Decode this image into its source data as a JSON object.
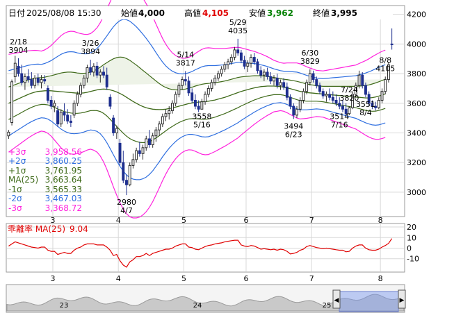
{
  "header": {
    "date_label": "日付",
    "datetime": "2025/08/08 15:30",
    "open_label": "始値",
    "open_value": "4,000",
    "high_label": "高値",
    "high_value": "4,105",
    "low_label": "安値",
    "low_value": "3,962",
    "close_label": "終値",
    "close_value": "3,995"
  },
  "colors": {
    "up": "#2b2b2b",
    "down": "#1e2f8e",
    "ma": "#3f6a1a",
    "sigma1": "#3f6a1a",
    "sigma2": "#2f6fe0",
    "sigma3": "#ff22dd",
    "deviation": "#e00000",
    "high_value": "#e00000",
    "low_value": "#008000"
  },
  "legend": [
    {
      "label": "+3σ",
      "value": "3,958.56",
      "color": "#ff22dd"
    },
    {
      "label": "+2σ",
      "value": "3,860.25",
      "color": "#2f6fe0"
    },
    {
      "label": "+1σ",
      "value": "3,761.95",
      "color": "#3f6a1a"
    },
    {
      "label": "MA(25)",
      "value": "3,663.64",
      "color": "#3f6a1a"
    },
    {
      "label": "-1σ",
      "value": "3,565.33",
      "color": "#3f6a1a"
    },
    {
      "label": "-2σ",
      "value": "3,467.03",
      "color": "#2f6fe0"
    },
    {
      "label": "-3σ",
      "value": "3,368.72",
      "color": "#ff22dd"
    }
  ],
  "deviation_label": "乖離率 MA(25)",
  "deviation_value": "9.04",
  "navigator": {
    "ticks": [
      "23",
      "24",
      "25"
    ]
  },
  "chart_data": {
    "type": "candlestick",
    "title": "",
    "y_axis": {
      "ticks": [
        3000,
        3200,
        3400,
        3600,
        3800,
        4000,
        4200
      ],
      "range": [
        2840,
        4250
      ]
    },
    "x_axis": {
      "month_ticks": [
        {
          "label": "3",
          "index": 14
        },
        {
          "label": "4",
          "index": 34
        },
        {
          "label": "5",
          "index": 54
        },
        {
          "label": "6",
          "index": 73
        },
        {
          "label": "7",
          "index": 93
        },
        {
          "label": "8",
          "index": 114
        }
      ]
    },
    "candles": [
      [
        3380,
        3420,
        3360,
        3405
      ],
      [
        3470,
        3760,
        3450,
        3745
      ],
      [
        3780,
        3920,
        3740,
        3870
      ],
      [
        3850,
        3904,
        3780,
        3800
      ],
      [
        3800,
        3860,
        3720,
        3740
      ],
      [
        3740,
        3800,
        3690,
        3780
      ],
      [
        3780,
        3830,
        3740,
        3760
      ],
      [
        3760,
        3810,
        3700,
        3720
      ],
      [
        3720,
        3790,
        3700,
        3770
      ],
      [
        3770,
        3800,
        3720,
        3740
      ],
      [
        3740,
        3790,
        3700,
        3760
      ],
      [
        3760,
        3790,
        3730,
        3750
      ],
      [
        3700,
        3720,
        3600,
        3620
      ],
      [
        3620,
        3650,
        3560,
        3580
      ],
      [
        3580,
        3620,
        3540,
        3600
      ],
      [
        3550,
        3580,
        3440,
        3460
      ],
      [
        3460,
        3560,
        3440,
        3540
      ],
      [
        3540,
        3600,
        3480,
        3520
      ],
      [
        3520,
        3560,
        3460,
        3480
      ],
      [
        3480,
        3520,
        3440,
        3470
      ],
      [
        3520,
        3620,
        3500,
        3600
      ],
      [
        3600,
        3680,
        3580,
        3660
      ],
      [
        3660,
        3740,
        3640,
        3720
      ],
      [
        3720,
        3790,
        3700,
        3770
      ],
      [
        3770,
        3860,
        3740,
        3840
      ],
      [
        3840,
        3894,
        3790,
        3810
      ],
      [
        3810,
        3870,
        3780,
        3850
      ],
      [
        3850,
        3880,
        3770,
        3790
      ],
      [
        3790,
        3830,
        3740,
        3810
      ],
      [
        3810,
        3850,
        3770,
        3790
      ],
      [
        3790,
        3840,
        3690,
        3710
      ],
      [
        3640,
        3660,
        3560,
        3580
      ],
      [
        3500,
        3520,
        3380,
        3400
      ],
      [
        3400,
        3450,
        3360,
        3430
      ],
      [
        3330,
        3360,
        3180,
        3200
      ],
      [
        3200,
        3280,
        3060,
        3080
      ],
      [
        3080,
        3120,
        2980,
        3050
      ],
      [
        3050,
        3200,
        3040,
        3180
      ],
      [
        3180,
        3260,
        3160,
        3220
      ],
      [
        3220,
        3300,
        3200,
        3280
      ],
      [
        3280,
        3340,
        3240,
        3260
      ],
      [
        3260,
        3320,
        3220,
        3300
      ],
      [
        3300,
        3380,
        3280,
        3360
      ],
      [
        3360,
        3420,
        3300,
        3320
      ],
      [
        3320,
        3400,
        3300,
        3380
      ],
      [
        3380,
        3440,
        3340,
        3420
      ],
      [
        3420,
        3480,
        3380,
        3460
      ],
      [
        3460,
        3530,
        3440,
        3510
      ],
      [
        3510,
        3560,
        3480,
        3530
      ],
      [
        3530,
        3580,
        3490,
        3550
      ],
      [
        3550,
        3620,
        3530,
        3600
      ],
      [
        3600,
        3680,
        3580,
        3660
      ],
      [
        3660,
        3740,
        3640,
        3720
      ],
      [
        3720,
        3780,
        3690,
        3760
      ],
      [
        3760,
        3817,
        3720,
        3750
      ],
      [
        3750,
        3780,
        3650,
        3670
      ],
      [
        3670,
        3700,
        3600,
        3620
      ],
      [
        3620,
        3660,
        3560,
        3580
      ],
      [
        3580,
        3620,
        3540,
        3560
      ],
      [
        3560,
        3630,
        3558,
        3610
      ],
      [
        3610,
        3680,
        3590,
        3660
      ],
      [
        3660,
        3720,
        3640,
        3700
      ],
      [
        3700,
        3760,
        3680,
        3740
      ],
      [
        3740,
        3790,
        3720,
        3770
      ],
      [
        3770,
        3820,
        3750,
        3800
      ],
      [
        3800,
        3850,
        3780,
        3830
      ],
      [
        3830,
        3880,
        3810,
        3860
      ],
      [
        3860,
        3900,
        3830,
        3880
      ],
      [
        3880,
        3930,
        3860,
        3910
      ],
      [
        3910,
        3980,
        3890,
        3960
      ],
      [
        3960,
        4035,
        3920,
        3940
      ],
      [
        3940,
        3960,
        3870,
        3890
      ],
      [
        3890,
        3920,
        3830,
        3850
      ],
      [
        3850,
        3890,
        3810,
        3870
      ],
      [
        3870,
        3930,
        3840,
        3910
      ],
      [
        3910,
        3940,
        3860,
        3880
      ],
      [
        3880,
        3900,
        3800,
        3820
      ],
      [
        3820,
        3850,
        3770,
        3790
      ],
      [
        3790,
        3830,
        3750,
        3810
      ],
      [
        3810,
        3840,
        3760,
        3780
      ],
      [
        3780,
        3810,
        3730,
        3750
      ],
      [
        3750,
        3790,
        3720,
        3770
      ],
      [
        3770,
        3800,
        3700,
        3720
      ],
      [
        3720,
        3760,
        3690,
        3740
      ],
      [
        3740,
        3770,
        3690,
        3710
      ],
      [
        3710,
        3740,
        3620,
        3640
      ],
      [
        3640,
        3660,
        3560,
        3580
      ],
      [
        3580,
        3600,
        3494,
        3520
      ],
      [
        3520,
        3580,
        3500,
        3560
      ],
      [
        3560,
        3640,
        3540,
        3620
      ],
      [
        3620,
        3700,
        3600,
        3680
      ],
      [
        3680,
        3760,
        3660,
        3740
      ],
      [
        3740,
        3829,
        3720,
        3800
      ],
      [
        3800,
        3820,
        3740,
        3760
      ],
      [
        3760,
        3780,
        3700,
        3720
      ],
      [
        3720,
        3740,
        3660,
        3680
      ],
      [
        3680,
        3700,
        3630,
        3650
      ],
      [
        3650,
        3680,
        3610,
        3660
      ],
      [
        3660,
        3700,
        3620,
        3640
      ],
      [
        3640,
        3680,
        3600,
        3620
      ],
      [
        3620,
        3660,
        3580,
        3600
      ],
      [
        3600,
        3640,
        3560,
        3580
      ],
      [
        3580,
        3620,
        3540,
        3560
      ],
      [
        3560,
        3600,
        3514,
        3530
      ],
      [
        3530,
        3580,
        3520,
        3570
      ],
      [
        3570,
        3680,
        3560,
        3660
      ],
      [
        3660,
        3740,
        3640,
        3720
      ],
      [
        3720,
        3820,
        3700,
        3790
      ],
      [
        3790,
        3810,
        3700,
        3720
      ],
      [
        3720,
        3740,
        3640,
        3660
      ],
      [
        3660,
        3680,
        3580,
        3600
      ],
      [
        3600,
        3620,
        3560,
        3580
      ],
      [
        3580,
        3610,
        3551,
        3570
      ],
      [
        3570,
        3640,
        3560,
        3620
      ],
      [
        3620,
        3700,
        3600,
        3680
      ],
      [
        3680,
        3780,
        3660,
        3760
      ],
      [
        3760,
        3880,
        3740,
        3860
      ],
      [
        4000,
        4105,
        3962,
        3995
      ]
    ],
    "ma25": [
      3600,
      3610,
      3620,
      3630,
      3640,
      3650,
      3660,
      3668,
      3675,
      3680,
      3682,
      3684,
      3685,
      3684,
      3682,
      3680,
      3678,
      3676,
      3674,
      3672,
      3670,
      3668,
      3668,
      3670,
      3674,
      3680,
      3685,
      3690,
      3694,
      3696,
      3694,
      3690,
      3684,
      3676,
      3666,
      3654,
      3640,
      3626,
      3612,
      3600,
      3588,
      3578,
      3570,
      3564,
      3560,
      3558,
      3557,
      3558,
      3560,
      3564,
      3568,
      3574,
      3580,
      3586,
      3592,
      3598,
      3602,
      3606,
      3608,
      3610,
      3612,
      3614,
      3618,
      3622,
      3628,
      3634,
      3640,
      3648,
      3656,
      3664,
      3672,
      3680,
      3686,
      3692,
      3698,
      3704,
      3708,
      3712,
      3714,
      3716,
      3716,
      3716,
      3714,
      3712,
      3708,
      3704,
      3698,
      3692,
      3686,
      3680,
      3676,
      3672,
      3670,
      3668,
      3666,
      3664,
      3662,
      3660,
      3658,
      3656,
      3654,
      3652,
      3650,
      3648,
      3646,
      3644,
      3642,
      3640,
      3638,
      3636,
      3636,
      3638,
      3642,
      3648,
      3656,
      3663.64
    ],
    "sigma": [
      110,
      108,
      106,
      104,
      102,
      100,
      98,
      96,
      94,
      92,
      90,
      92,
      96,
      102,
      110,
      118,
      126,
      132,
      136,
      138,
      138,
      136,
      134,
      132,
      130,
      130,
      134,
      140,
      150,
      164,
      180,
      198,
      216,
      232,
      246,
      256,
      262,
      264,
      262,
      258,
      252,
      244,
      234,
      222,
      208,
      192,
      176,
      160,
      146,
      134,
      124,
      116,
      110,
      106,
      104,
      104,
      106,
      110,
      114,
      118,
      120,
      120,
      118,
      116,
      114,
      112,
      110,
      108,
      106,
      104,
      102,
      98,
      94,
      90,
      86,
      82,
      78,
      74,
      70,
      66,
      62,
      58,
      56,
      54,
      54,
      56,
      58,
      60,
      62,
      62,
      60,
      58,
      56,
      54,
      52,
      52,
      52,
      54,
      56,
      58,
      60,
      62,
      64,
      66,
      68,
      70,
      72,
      76,
      80,
      84,
      88,
      92,
      95,
      97,
      98,
      98.31
    ],
    "deviation": [
      2,
      4,
      6,
      5,
      4,
      3,
      2,
      1,
      0.5,
      0,
      1,
      1,
      -2,
      -3,
      -3,
      -6,
      -5,
      -4,
      -5,
      -5,
      -2,
      0,
      1,
      3,
      4,
      4,
      4,
      3,
      3,
      3,
      1,
      -2,
      -7,
      -6,
      -12,
      -16,
      -18,
      -13,
      -11,
      -8,
      -8,
      -7,
      -5,
      -7,
      -5,
      -4,
      -3,
      -2,
      -1,
      -1,
      0,
      2,
      3,
      4,
      4,
      1,
      0.5,
      -1,
      -1.5,
      0,
      1.5,
      2.5,
      3,
      4,
      4.5,
      5,
      6,
      6.5,
      7,
      7.5,
      7.5,
      3,
      2,
      1.5,
      2.5,
      2,
      0.5,
      -1,
      -0.5,
      -1,
      -1.5,
      -1,
      -2,
      -1,
      -1.5,
      -3,
      -5.5,
      -5,
      -4,
      -2,
      -1,
      1.5,
      2.5,
      1.5,
      0.5,
      0,
      -0.5,
      0,
      -0.5,
      -1,
      -1.5,
      -2,
      -2,
      -3.5,
      -3,
      0,
      2,
      3,
      3,
      0,
      -1.5,
      -2,
      -2,
      -1,
      1,
      2.5,
      4.5,
      9.04
    ],
    "deviation_axis": {
      "ticks": [
        20,
        10,
        0,
        -10
      ],
      "range": [
        -22,
        22
      ]
    },
    "annotations": [
      {
        "index": 3,
        "date": "2/18",
        "value": "3904",
        "pos": "above"
      },
      {
        "index": 25,
        "date": "3/26",
        "value": "3894",
        "pos": "above"
      },
      {
        "index": 36,
        "date": "4/7",
        "value": "2980",
        "pos": "below"
      },
      {
        "index": 54,
        "date": "5/14",
        "value": "3817",
        "pos": "above"
      },
      {
        "index": 59,
        "date": "5/16",
        "value": "3558",
        "pos": "below"
      },
      {
        "index": 70,
        "date": "5/29",
        "value": "4035",
        "pos": "above"
      },
      {
        "index": 87,
        "date": "6/23",
        "value": "3494",
        "pos": "below"
      },
      {
        "index": 92,
        "date": "6/30",
        "value": "3829",
        "pos": "above"
      },
      {
        "index": 101,
        "date": "7/16",
        "value": "3514",
        "pos": "below"
      },
      {
        "index": 104,
        "date": "7/24",
        "value": "3820",
        "pos": "above"
      },
      {
        "index": 109,
        "date": "8/4",
        "value": "3551",
        "pos": "below"
      },
      {
        "index": 115,
        "date": "8/8",
        "value": "4105",
        "pos": "above"
      }
    ]
  }
}
